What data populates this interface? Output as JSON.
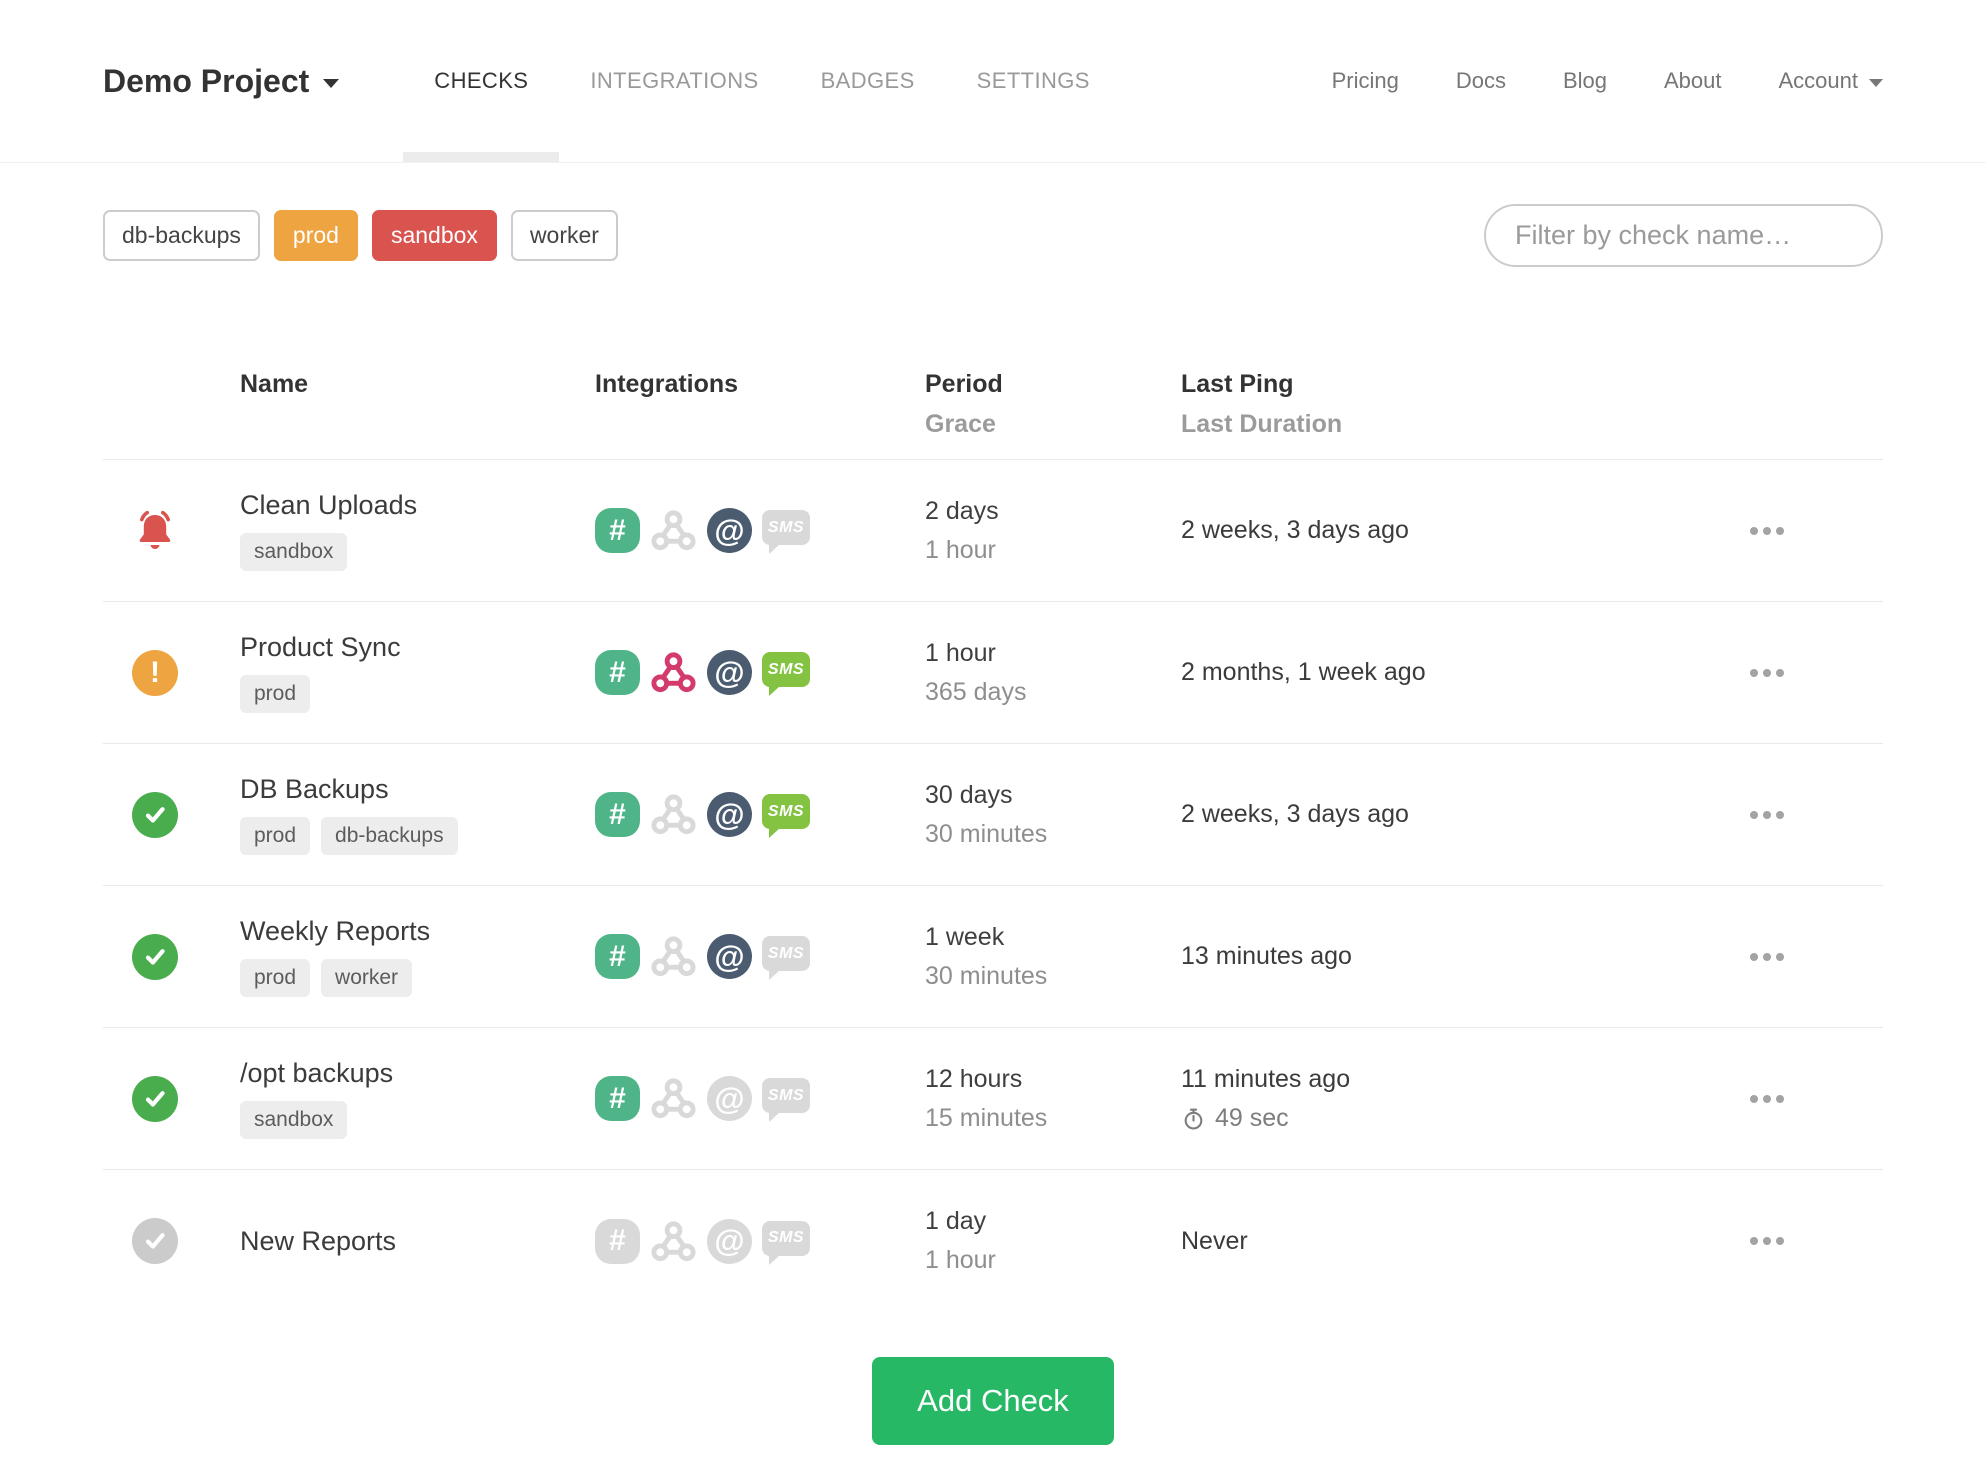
{
  "nav": {
    "project_name": "Demo Project",
    "tabs": [
      {
        "label": "CHECKS",
        "active": true
      },
      {
        "label": "INTEGRATIONS",
        "active": false
      },
      {
        "label": "BADGES",
        "active": false
      },
      {
        "label": "SETTINGS",
        "active": false
      }
    ],
    "links": [
      {
        "label": "Pricing"
      },
      {
        "label": "Docs"
      },
      {
        "label": "Blog"
      },
      {
        "label": "About"
      },
      {
        "label": "Account",
        "has_dropdown": true
      }
    ]
  },
  "filter_bar": {
    "tags": [
      {
        "label": "db-backups",
        "variant": "default"
      },
      {
        "label": "prod",
        "variant": "orange"
      },
      {
        "label": "sandbox",
        "variant": "red"
      },
      {
        "label": "worker",
        "variant": "default"
      }
    ],
    "search_placeholder": "Filter by check name…"
  },
  "table": {
    "headers": {
      "name": "Name",
      "integrations": "Integrations",
      "period": "Period",
      "grace": "Grace",
      "last_ping": "Last Ping",
      "last_duration": "Last Duration"
    }
  },
  "glyphs": {
    "slack": "#",
    "email": "@",
    "sms": "SMS",
    "exclamation": "!"
  },
  "checks": [
    {
      "status": "down",
      "name": "Clean Uploads",
      "tags": [
        "sandbox"
      ],
      "integrations": {
        "slack": true,
        "webhook": false,
        "email": true,
        "sms": false
      },
      "period": "2 days",
      "grace": "1 hour",
      "last_ping": "2 weeks, 3 days ago",
      "last_duration": ""
    },
    {
      "status": "late",
      "name": "Product Sync",
      "tags": [
        "prod"
      ],
      "integrations": {
        "slack": true,
        "webhook": true,
        "email": true,
        "sms": true
      },
      "period": "1 hour",
      "grace": "365 days",
      "last_ping": "2 months, 1 week ago",
      "last_duration": ""
    },
    {
      "status": "up",
      "name": "DB Backups",
      "tags": [
        "prod",
        "db-backups"
      ],
      "integrations": {
        "slack": true,
        "webhook": false,
        "email": true,
        "sms": true
      },
      "period": "30 days",
      "grace": "30 minutes",
      "last_ping": "2 weeks, 3 days ago",
      "last_duration": ""
    },
    {
      "status": "up",
      "name": "Weekly Reports",
      "tags": [
        "prod",
        "worker"
      ],
      "integrations": {
        "slack": true,
        "webhook": false,
        "email": true,
        "sms": false
      },
      "period": "1 week",
      "grace": "30 minutes",
      "last_ping": "13 minutes ago",
      "last_duration": ""
    },
    {
      "status": "up",
      "name": "/opt backups",
      "tags": [
        "sandbox"
      ],
      "integrations": {
        "slack": true,
        "webhook": false,
        "email": false,
        "sms": false
      },
      "period": "12 hours",
      "grace": "15 minutes",
      "last_ping": "11 minutes ago",
      "last_duration": "49 sec"
    },
    {
      "status": "new",
      "name": "New Reports",
      "tags": [],
      "integrations": {
        "slack": false,
        "webhook": false,
        "email": false,
        "sms": false
      },
      "period": "1 day",
      "grace": "1 hour",
      "last_ping": "Never",
      "last_duration": ""
    }
  ],
  "footer": {
    "add_check_label": "Add Check"
  },
  "colors": {
    "accent_green": "#26b865",
    "status_down_red": "#d9534f",
    "status_late_orange": "#eea440",
    "status_up_green": "#49ad4e",
    "status_new_gray": "#cbcbcb",
    "tag_orange": "#eea440",
    "tag_red": "#d9534f",
    "slack_green": "#4fb588",
    "webhook_crimson": "#d23b6b",
    "email_navy": "#4b5c71",
    "sms_green": "#84c341",
    "inactive_icon_gray": "#d9d9d9"
  }
}
